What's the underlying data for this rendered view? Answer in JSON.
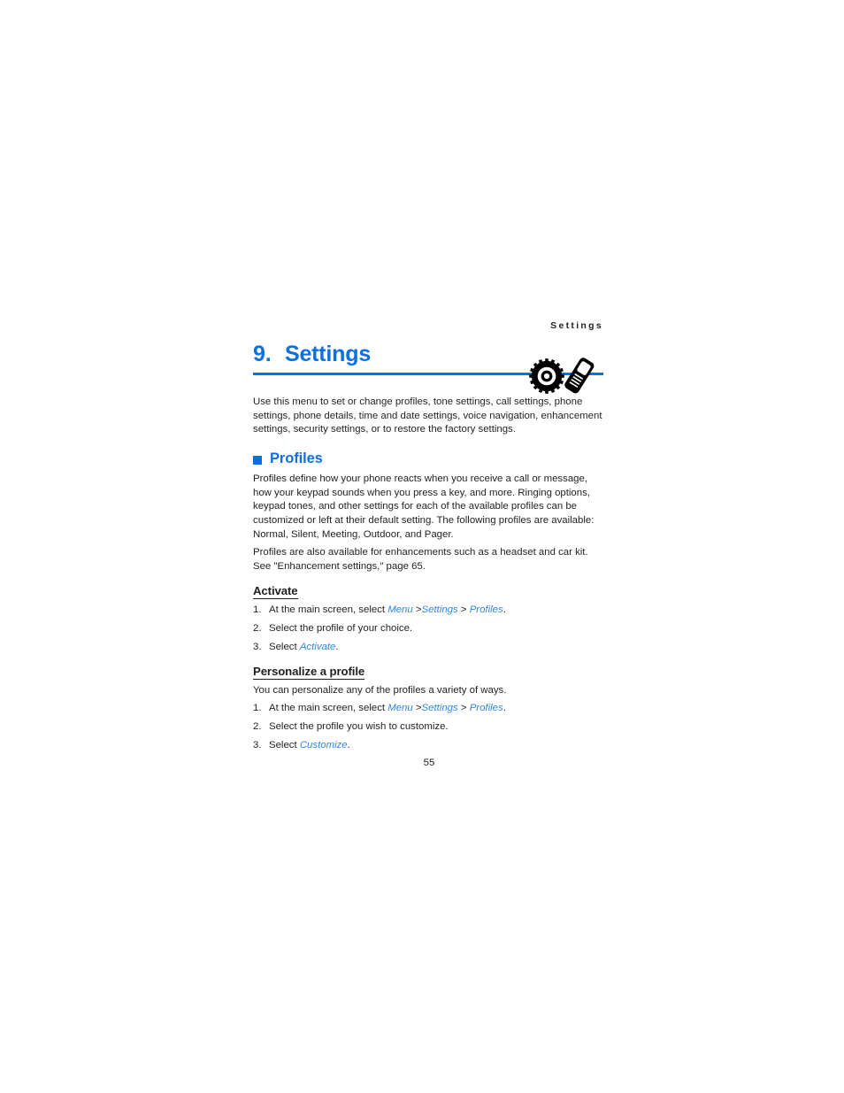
{
  "page": {
    "running_head": "Settings",
    "page_number": "55",
    "accent_color": "#0d6fe0",
    "link_color": "#2f86e8",
    "text_color": "#231f20",
    "background": "#ffffff"
  },
  "chapter": {
    "number": "9.",
    "title": "Settings",
    "icons": [
      {
        "name": "gear-icon",
        "label": "settings-gear"
      },
      {
        "name": "mobile-phone-icon",
        "label": "mobile-phone"
      }
    ],
    "intro": "Use this menu to set or change profiles, tone settings, call settings, phone settings, phone details, time and date settings, voice navigation, enhancement settings, security settings, or to restore the factory settings."
  },
  "section": {
    "heading": "Profiles",
    "paragraph_1": "Profiles define how your phone reacts when you receive a call or message, how your keypad sounds when you press a key, and more. Ringing options, keypad tones, and other settings for each of the available profiles can be customized or left at their default setting. The following profiles are available: Normal, Silent, Meeting, Outdoor, and Pager.",
    "paragraph_2": "Profiles are also available for enhancements such as a headset and car kit. See \"Enhancement settings,\" page 65."
  },
  "activate": {
    "heading": "Activate",
    "steps": [
      {
        "num": "1.",
        "prefix": "At the main screen, select ",
        "menu_1": "Menu",
        "sep_1": " >",
        "menu_2": "Settings",
        "sep_2": " > ",
        "menu_3": "Profiles",
        "suffix": "."
      },
      {
        "num": "2.",
        "text": "Select the profile of your choice."
      },
      {
        "num": "3.",
        "prefix": "Select ",
        "menu_1": "Activate",
        "suffix": "."
      }
    ]
  },
  "personalize": {
    "heading": "Personalize a profile",
    "intro": "You can personalize any of the profiles a variety of ways.",
    "steps": [
      {
        "num": "1.",
        "prefix": "At the main screen, select ",
        "menu_1": "Menu",
        "sep_1": " >",
        "menu_2": "Settings",
        "sep_2": " > ",
        "menu_3": "Profiles",
        "suffix": "."
      },
      {
        "num": "2.",
        "text": "Select the profile you wish to customize."
      },
      {
        "num": "3.",
        "prefix": "Select ",
        "menu_1": "Customize",
        "suffix": "."
      }
    ]
  }
}
